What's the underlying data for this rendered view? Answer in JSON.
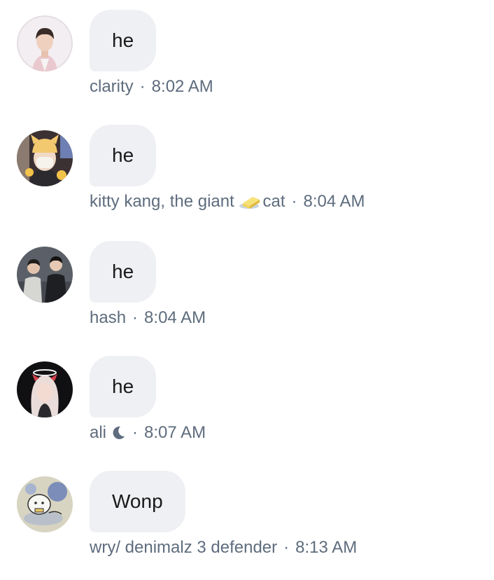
{
  "messages": [
    {
      "text": "he",
      "author": "clarity",
      "author_suffix": "",
      "author_icon": "",
      "time": "8:02 AM",
      "avatar_icon": "avatar-clarity-icon"
    },
    {
      "text": "he",
      "author": "kitty kang, the giant ",
      "author_suffix": "cat",
      "author_icon": "butter-icon",
      "time": "8:04 AM",
      "avatar_icon": "avatar-kitty-icon"
    },
    {
      "text": "he",
      "author": "hash",
      "author_suffix": "",
      "author_icon": "",
      "time": "8:04 AM",
      "avatar_icon": "avatar-hash-icon"
    },
    {
      "text": "he",
      "author": "ali",
      "author_suffix": "",
      "author_icon": "crescent-moon-icon",
      "time": "8:07 AM",
      "avatar_icon": "avatar-ali-icon"
    },
    {
      "text": "Wonp",
      "author": "wry/ denimalz 3 defender",
      "author_suffix": "",
      "author_icon": "",
      "time": "8:13 AM",
      "avatar_icon": "avatar-wry-icon"
    }
  ],
  "separator": "·",
  "colors": {
    "bubble_bg": "#eff0f3",
    "meta_text": "#5e6c7d",
    "message_text": "#1a1a1a"
  }
}
